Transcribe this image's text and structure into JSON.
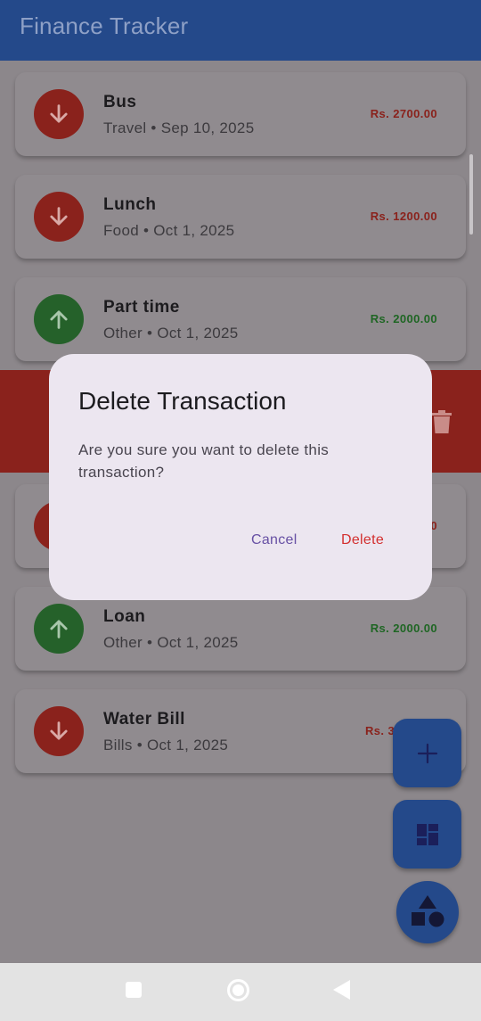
{
  "app": {
    "title": "Finance Tracker"
  },
  "transactions": [
    {
      "title": "Bus",
      "subtitle": "Travel • Sep 10, 2025",
      "amount": "Rs. 2700.00",
      "type": "expense",
      "icon": "arrow-down-icon"
    },
    {
      "title": "Lunch",
      "subtitle": "Food • Oct 1, 2025",
      "amount": "Rs. 1200.00",
      "type": "expense",
      "icon": "arrow-down-icon"
    },
    {
      "title": "Part time",
      "subtitle": "Other • Oct 1, 2025",
      "amount": "Rs. 2000.00",
      "type": "income",
      "icon": "arrow-up-icon"
    },
    {
      "amount_partial": "0",
      "type": "expense",
      "icon": "arrow-down-icon"
    },
    {
      "title": "Loan",
      "subtitle": "Other • Oct 1, 2025",
      "amount": "Rs. 2000.00",
      "type": "income",
      "icon": "arrow-up-icon"
    },
    {
      "title": "Water Bill",
      "subtitle": "Bills • Oct 1, 2025",
      "amount_partial": "Rs. 3",
      "type": "expense",
      "icon": "arrow-down-icon"
    }
  ],
  "swipe": {
    "icon": "trash-icon"
  },
  "fabs": [
    {
      "name": "add",
      "icon": "plus-icon"
    },
    {
      "name": "dashboard",
      "icon": "dashboard-icon"
    },
    {
      "name": "categories",
      "icon": "shapes-icon"
    }
  ],
  "dialog": {
    "title": "Delete Transaction",
    "message": "Are you sure you want to delete this transaction?",
    "cancel_label": "Cancel",
    "delete_label": "Delete"
  },
  "colors": {
    "primary": "#24498a",
    "expense": "#d32f2f",
    "income": "#2e7d32",
    "dialog_bg": "#ece6f0"
  },
  "navbar": {
    "icons": [
      "recents-icon",
      "home-icon",
      "back-icon"
    ]
  }
}
